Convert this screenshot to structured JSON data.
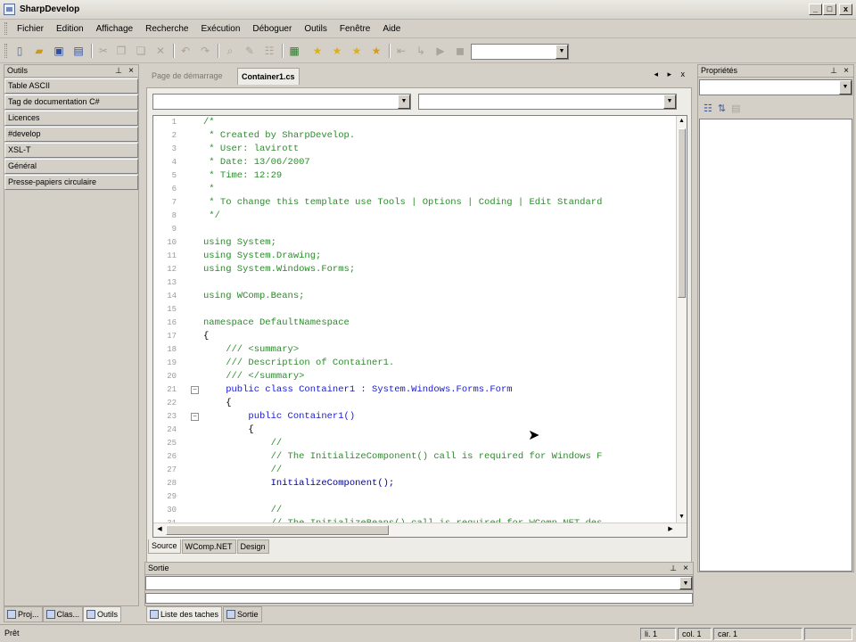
{
  "window": {
    "title": "SharpDevelop",
    "min": "_",
    "max": "□",
    "close": "x"
  },
  "menu": [
    "Fichier",
    "Edition",
    "Affichage",
    "Recherche",
    "Exécution",
    "Déboguer",
    "Outils",
    "Fenêtre",
    "Aide"
  ],
  "toolbar_icons": [
    {
      "name": "new-file-icon",
      "glyph": "▯",
      "color": "#5a6a8a",
      "disabled": false
    },
    {
      "name": "open-folder-icon",
      "glyph": "▰",
      "color": "#c89a20",
      "disabled": false
    },
    {
      "name": "save-icon",
      "glyph": "▣",
      "color": "#3050a0",
      "disabled": false
    },
    {
      "name": "save-all-icon",
      "glyph": "▤",
      "color": "#3050a0",
      "disabled": false
    },
    {
      "name": "cut-icon",
      "glyph": "✂",
      "color": "#a8a49c",
      "disabled": true
    },
    {
      "name": "copy-icon",
      "glyph": "❐",
      "color": "#a8a49c",
      "disabled": true
    },
    {
      "name": "paste-icon",
      "glyph": "❏",
      "color": "#a8a49c",
      "disabled": true
    },
    {
      "name": "delete-icon",
      "glyph": "✕",
      "color": "#a8a49c",
      "disabled": true
    },
    {
      "name": "undo-icon",
      "glyph": "↶",
      "color": "#a8a49c",
      "disabled": true
    },
    {
      "name": "redo-icon",
      "glyph": "↷",
      "color": "#a8a49c",
      "disabled": true
    },
    {
      "name": "find-icon",
      "glyph": "⌕",
      "color": "#a8a49c",
      "disabled": true
    },
    {
      "name": "find-replace-icon",
      "glyph": "✎",
      "color": "#a8a49c",
      "disabled": true
    },
    {
      "name": "find-in-files-icon",
      "glyph": "☷",
      "color": "#a8a49c",
      "disabled": true
    },
    {
      "name": "toggle-output-icon",
      "glyph": "▦",
      "color": "#2a7a2a",
      "disabled": false
    },
    {
      "name": "bookmark-icon",
      "glyph": "★",
      "color": "#d8b020",
      "disabled": false
    },
    {
      "name": "bookmark-prev-icon",
      "glyph": "★",
      "color": "#d8b020",
      "disabled": false
    },
    {
      "name": "bookmark-next-icon",
      "glyph": "★",
      "color": "#d8b020",
      "disabled": false
    },
    {
      "name": "bookmark-clear-icon",
      "glyph": "★",
      "color": "#d89a20",
      "disabled": false
    },
    {
      "name": "step-back-icon",
      "glyph": "⇤",
      "color": "#a8a49c",
      "disabled": true
    },
    {
      "name": "step-icon",
      "glyph": "↳",
      "color": "#a8a49c",
      "disabled": true
    },
    {
      "name": "run-icon",
      "glyph": "▶",
      "color": "#a8a49c",
      "disabled": true
    },
    {
      "name": "stop-icon",
      "glyph": "◼",
      "color": "#a8a49c",
      "disabled": true
    }
  ],
  "left_panel": {
    "title": "Outils",
    "categories": [
      "Table ASCII",
      "Tag de documentation C#",
      "Licences",
      "#develop",
      "XSL-T",
      "Général",
      "Presse-papiers circulaire"
    ],
    "tabs": [
      {
        "label": "Proj...",
        "icon": "project-icon",
        "active": false
      },
      {
        "label": "Clas...",
        "icon": "classes-icon",
        "active": false
      },
      {
        "label": "Outils",
        "icon": "tools-icon",
        "active": true
      }
    ]
  },
  "doc_tabs": {
    "start_page": "Page de démarrage",
    "active": "Container1.cs",
    "nav": "◂ ▸ x"
  },
  "code_lines": [
    {
      "n": "1",
      "t": "/*",
      "cls": "c"
    },
    {
      "n": "2",
      "t": " * Created by SharpDevelop.",
      "cls": "c"
    },
    {
      "n": "3",
      "t": " * User: lavirott",
      "cls": "c"
    },
    {
      "n": "4",
      "t": " * Date: 13/06/2007",
      "cls": "c"
    },
    {
      "n": "5",
      "t": " * Time: 12:29",
      "cls": "c"
    },
    {
      "n": "6",
      "t": " *",
      "cls": "c"
    },
    {
      "n": "7",
      "t": " * To change this template use Tools | Options | Coding | Edit Standard",
      "cls": "c"
    },
    {
      "n": "8",
      "t": " */",
      "cls": "c"
    },
    {
      "n": "9",
      "t": "",
      "cls": ""
    },
    {
      "n": "10",
      "t": "using System;",
      "cls": "k"
    },
    {
      "n": "11",
      "t": "using System.Drawing;",
      "cls": "k"
    },
    {
      "n": "12",
      "t": "using System.Windows.Forms;",
      "cls": "k"
    },
    {
      "n": "13",
      "t": "",
      "cls": ""
    },
    {
      "n": "14",
      "t": "using WComp.Beans;",
      "cls": "k"
    },
    {
      "n": "15",
      "t": "",
      "cls": ""
    },
    {
      "n": "16",
      "t": "namespace DefaultNamespace",
      "cls": "k"
    },
    {
      "n": "17",
      "t": "{",
      "cls": ""
    },
    {
      "n": "18",
      "t": "    /// <summary>",
      "cls": "c"
    },
    {
      "n": "19",
      "t": "    /// Description of Container1.",
      "cls": "c"
    },
    {
      "n": "20",
      "t": "    /// </summary>",
      "cls": "c"
    },
    {
      "n": "21",
      "t": "    public class Container1 : System.Windows.Forms.Form",
      "cls": "kb",
      "fold": "⊟"
    },
    {
      "n": "22",
      "t": "    {",
      "cls": ""
    },
    {
      "n": "23",
      "t": "        public Container1()",
      "cls": "kb",
      "fold": "⊟"
    },
    {
      "n": "24",
      "t": "        {",
      "cls": ""
    },
    {
      "n": "25",
      "t": "            //",
      "cls": "c"
    },
    {
      "n": "26",
      "t": "            // The InitializeComponent() call is required for Windows F",
      "cls": "c"
    },
    {
      "n": "27",
      "t": "            //",
      "cls": "c"
    },
    {
      "n": "28",
      "t": "            InitializeComponent();",
      "cls": "m"
    },
    {
      "n": "29",
      "t": "",
      "cls": ""
    },
    {
      "n": "30",
      "t": "            //",
      "cls": "c"
    },
    {
      "n": "31",
      "t": "            // The InitializeBeans() call is required for WComp.NET des",
      "cls": "c"
    }
  ],
  "view_tabs": [
    {
      "label": "Source",
      "active": true
    },
    {
      "label": "WComp.NET",
      "active": false
    },
    {
      "label": "Design",
      "active": false
    }
  ],
  "output_panel": {
    "title": "Sortie"
  },
  "bottom_tabs": [
    {
      "label": "Liste des taches",
      "icon": "task-list-icon",
      "active": true
    },
    {
      "label": "Sortie",
      "icon": "output-icon",
      "active": false
    }
  ],
  "properties_panel": {
    "title": "Propriétés"
  },
  "status": {
    "message": "Prêt",
    "line": "li. 1",
    "col": "col. 1",
    "car": "car. 1"
  }
}
